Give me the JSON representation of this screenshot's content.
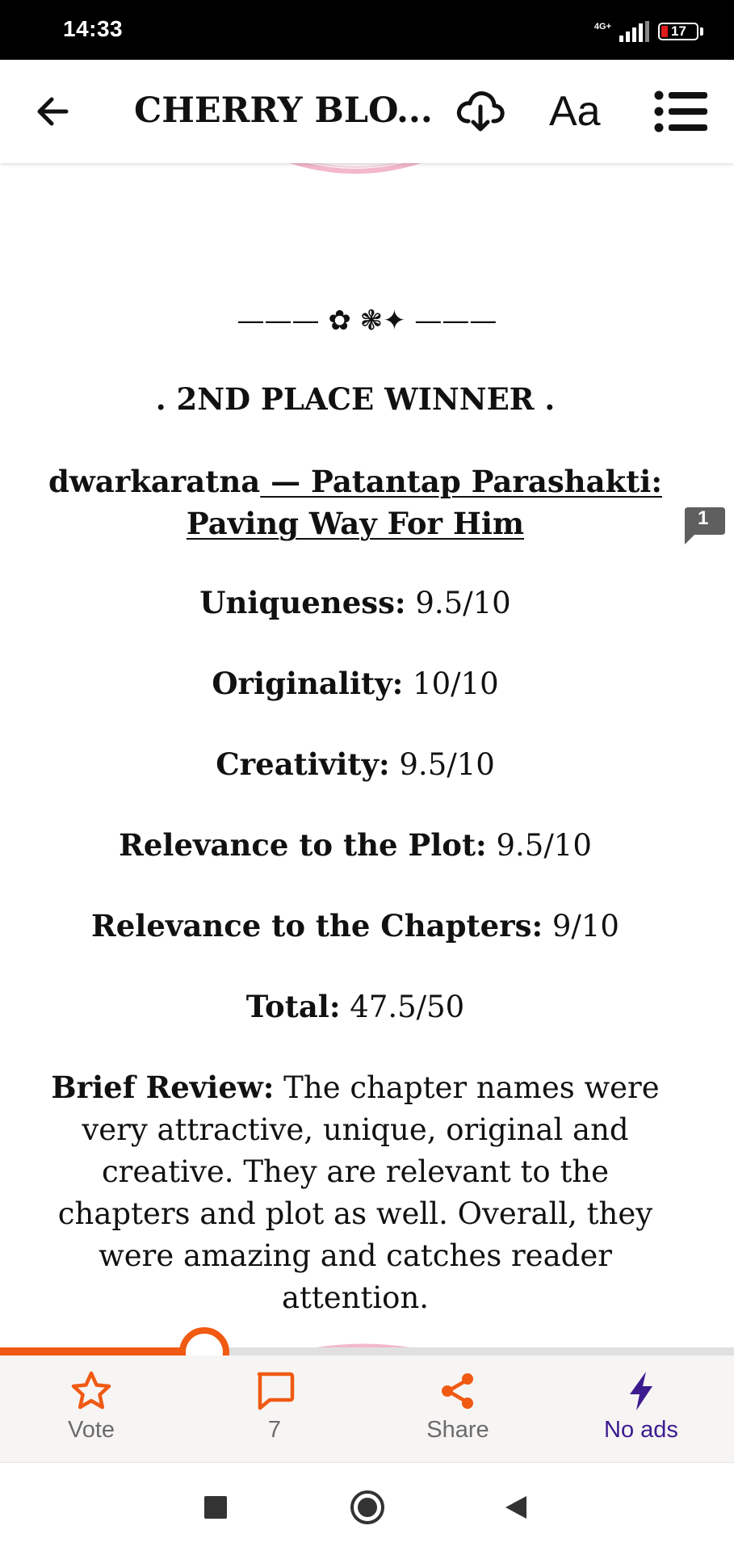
{
  "status_bar": {
    "time": "14:33",
    "network": "4G+",
    "battery": "17",
    "battery_color": "#e01b1b"
  },
  "app_bar": {
    "title": "CHERRY BLO...",
    "text_size_label": "Aa",
    "icons": [
      "arrow-left-icon",
      "download-cloud-icon",
      "text-size-icon",
      "list-icon"
    ]
  },
  "content": {
    "divider": "——— ✿ ❃✦ ———",
    "heading": ". 2ND PLACE WINNER .",
    "entry": {
      "author": "dwarkaratna",
      "title": " — Patantap Parashakti: Paving Way For Him"
    },
    "scores": [
      {
        "label": "Uniqueness:",
        "value": " 9.5/10"
      },
      {
        "label": "Originality:",
        "value": " 10/10"
      },
      {
        "label": "Creativity:",
        "value": " 9.5/10"
      },
      {
        "label": "Relevance to the Plot:",
        "value": " 9.5/10"
      },
      {
        "label": "Relevance to the Chapters:",
        "value": " 9/10"
      },
      {
        "label": "Total:",
        "value": " 47.5/50"
      }
    ],
    "review": {
      "label": "Brief Review:",
      "text": " The chapter names were very attractive, unique, original and creative. They are relevant to the chapters and plot as well. Overall, they were amazing and catches reader attention."
    },
    "inline_comment_count": "1"
  },
  "reading_progress": 0.27,
  "action_bar": {
    "vote_label": "Vote",
    "comments_count": "7",
    "share_label": "Share",
    "no_ads_label": "No ads"
  },
  "colors": {
    "accent": "#f05a13",
    "no_ads": "#3d1b8f",
    "ornament_pink": "#f3b8cc"
  }
}
